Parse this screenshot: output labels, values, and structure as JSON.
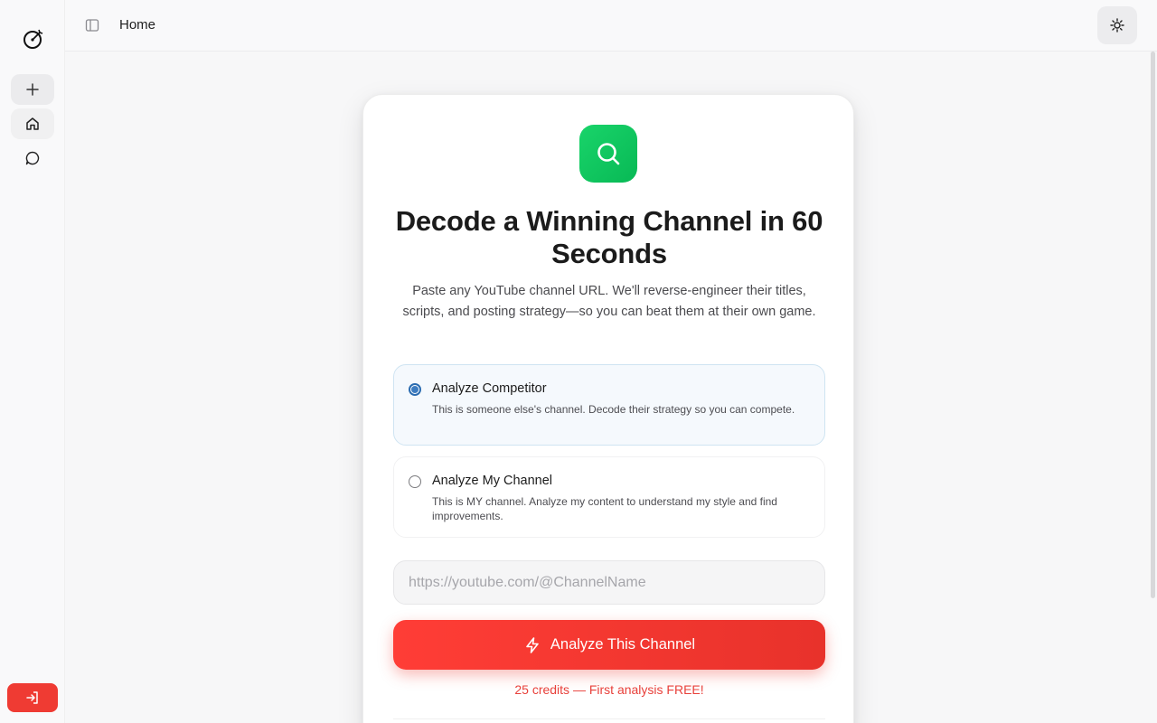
{
  "topbar": {
    "breadcrumb": "Home"
  },
  "sidebar": {
    "items": [
      {
        "name": "new",
        "icon": "plus-icon"
      },
      {
        "name": "home",
        "icon": "home-icon"
      },
      {
        "name": "chat",
        "icon": "chat-bubble-icon"
      }
    ],
    "login_icon": "sign-in-icon"
  },
  "card": {
    "title": "Decode a Winning Channel in 60 Seconds",
    "subtitle": "Paste any YouTube channel URL. We'll reverse-engineer their titles, scripts, and posting strategy—so you can beat them at their own game.",
    "options": [
      {
        "title": "Analyze Competitor",
        "description": "This is someone else's channel. Decode their strategy so you can compete.",
        "selected": true
      },
      {
        "title": "Analyze My Channel",
        "description": "This is MY channel. Analyze my content to understand my style and find improvements.",
        "selected": false
      }
    ],
    "url_placeholder": "https://youtube.com/@ChannelName",
    "cta_label": "Analyze This Channel",
    "credits_note": "25 credits — First analysis FREE!"
  },
  "colors": {
    "accent_red": "#ef3b33",
    "accent_green": "#10c45f",
    "selected_blue": "#2b6cb0"
  }
}
